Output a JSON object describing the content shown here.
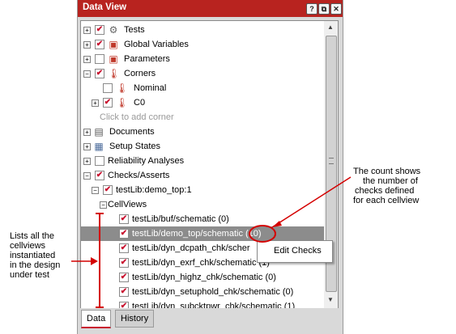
{
  "window": {
    "title": "Data View",
    "buttons": [
      "?",
      "⧉",
      "✕"
    ]
  },
  "tree": [
    {
      "label": "Tests",
      "checked": true,
      "expand": "+",
      "icon": "gears-icon"
    },
    {
      "label": "Global Variables",
      "checked": true,
      "expand": "+",
      "icon": "cubes-icon"
    },
    {
      "label": "Parameters",
      "checked": false,
      "expand": "+",
      "icon": "cubes-icon"
    },
    {
      "label": "Corners",
      "checked": true,
      "expand": "-",
      "icon": "thermometer-icon"
    },
    {
      "label": "Nominal",
      "checked": false,
      "expand": "",
      "icon": "thermometer-icon"
    },
    {
      "label": "C0",
      "checked": true,
      "expand": "+",
      "icon": "thermometer-icon"
    },
    {
      "label": "Click to add corner",
      "checked": null,
      "expand": "",
      "icon": ""
    },
    {
      "label": "Documents",
      "checked": null,
      "expand": "+",
      "icon": "document-icon"
    },
    {
      "label": "Setup States",
      "checked": null,
      "expand": "+",
      "icon": "state-icon"
    },
    {
      "label": "Reliability Analyses",
      "checked": false,
      "expand": "+",
      "icon": ""
    },
    {
      "label": "Checks/Asserts",
      "checked": true,
      "expand": "-",
      "icon": ""
    },
    {
      "label": "testLib:demo_top:1",
      "checked": true,
      "expand": "-",
      "icon": ""
    },
    {
      "label": "CellViews",
      "checked": null,
      "expand": "-",
      "icon": ""
    },
    {
      "label": "testLib/buf/schematic (0)",
      "checked": true,
      "expand": "",
      "icon": ""
    },
    {
      "label": "testLib/demo_top/schematic (10)",
      "checked": true,
      "expand": "",
      "icon": ""
    },
    {
      "label": "testLib/dyn_dcpath_chk/scher",
      "checked": true,
      "expand": "",
      "icon": ""
    },
    {
      "label": "testLib/dyn_exrf_chk/schematic (1)",
      "checked": true,
      "expand": "",
      "icon": ""
    },
    {
      "label": "testLib/dyn_highz_chk/schematic (0)",
      "checked": true,
      "expand": "",
      "icon": ""
    },
    {
      "label": "testLib/dyn_setuphold_chk/schematic (0)",
      "checked": true,
      "expand": "",
      "icon": ""
    },
    {
      "label": "testLib/dyn_subcktpwr_chk/schematic (1)",
      "checked": true,
      "expand": "",
      "icon": ""
    }
  ],
  "context_menu": {
    "item": "Edit Checks"
  },
  "tabs": [
    "Data",
    "History"
  ],
  "annotations": {
    "right": [
      "The count shows",
      "the number of",
      "checks defined",
      "for each cellview"
    ],
    "left": [
      "Lists all the",
      "cellviews",
      "instantiated",
      "in the design",
      "under test"
    ]
  },
  "colors": {
    "titlebar": "#b8231f",
    "check": "#c8102e",
    "selected_row": "#8c8c8c",
    "annotation": "#d40000"
  }
}
